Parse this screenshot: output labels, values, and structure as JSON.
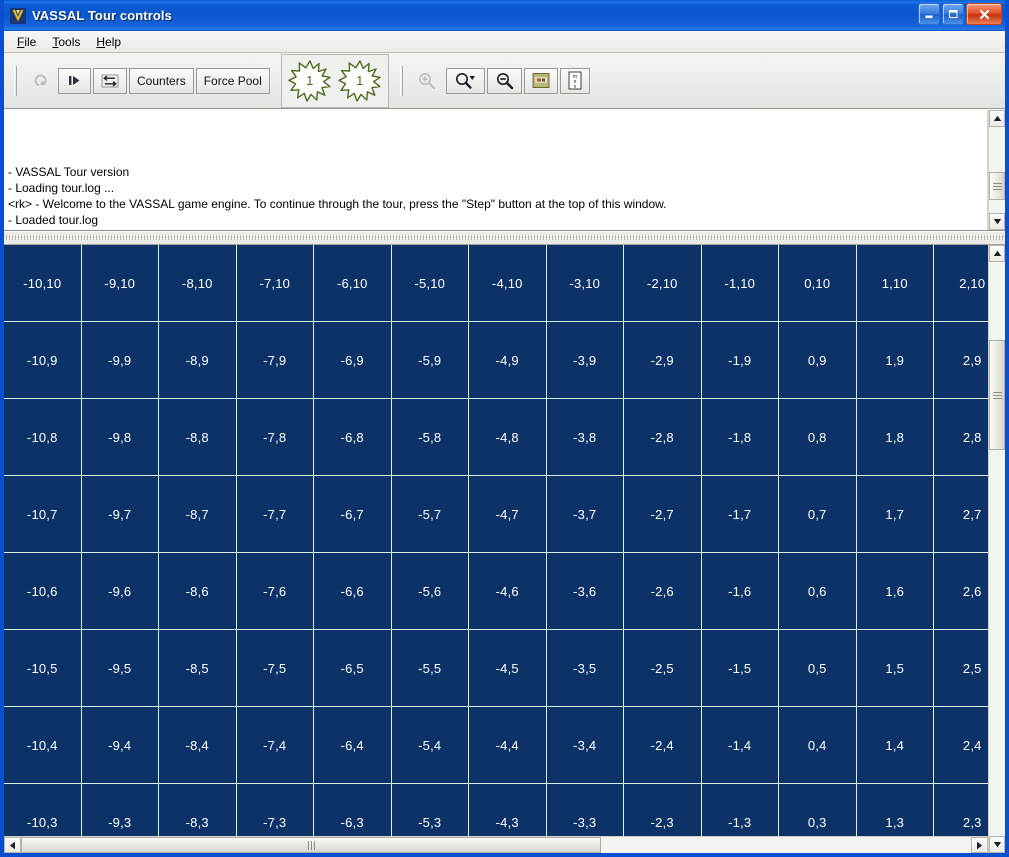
{
  "window": {
    "title": "VASSAL Tour controls",
    "icon": "vassal-logo-icon",
    "buttons": {
      "minimize": "minimize-icon",
      "maximize": "maximize-icon",
      "close": "close-icon"
    }
  },
  "menubar": {
    "items": [
      {
        "label": "File",
        "mnemonic": "F"
      },
      {
        "label": "Tools",
        "mnemonic": "T"
      },
      {
        "label": "Help",
        "mnemonic": "H"
      }
    ]
  },
  "toolbar": {
    "undo": {
      "name": "undo-button",
      "tooltip": "Undo",
      "enabled": false
    },
    "step": {
      "name": "step-button",
      "tooltip": "Step"
    },
    "swap": {
      "name": "swap-sides-button",
      "tooltip": "Swap sides"
    },
    "counters_label": "Counters",
    "force_pool_label": "Force Pool",
    "counter_badges": [
      {
        "label": "1",
        "color": "#4a6b1e"
      },
      {
        "label": "1",
        "color": "#4a6b1e"
      }
    ],
    "zoom_in": {
      "name": "zoom-in-button",
      "enabled": false
    },
    "zoom_select": {
      "name": "zoom-select-button",
      "enabled": true
    },
    "zoom_out": {
      "name": "zoom-out-button",
      "enabled": true
    },
    "overview": {
      "name": "overview-map-button",
      "enabled": true
    },
    "mov": {
      "name": "mov-marker-button",
      "label": "mov",
      "enabled": true
    }
  },
  "log": {
    "lines": [
      "- VASSAL Tour version",
      "- Loading tour.log ...",
      "<rk> - Welcome to the VASSAL game engine.  To continue through the tour, press the \"Step\" button at the top of this window.",
      "- Loaded tour.log"
    ]
  },
  "map": {
    "background_color": "#0d3268",
    "gridline_color": "#d9f0e4",
    "label_color": "#ffffff",
    "columns": [
      -10,
      -9,
      -8,
      -7,
      -6,
      -5,
      -4,
      -3,
      -2,
      -1,
      0,
      1,
      2
    ],
    "rows": [
      10,
      9,
      8,
      7,
      6,
      5,
      4,
      3
    ],
    "cells": [
      [
        "-10,10",
        "-9,10",
        "-8,10",
        "-7,10",
        "-6,10",
        "-5,10",
        "-4,10",
        "-3,10",
        "-2,10",
        "-1,10",
        "0,10",
        "1,10",
        "2,10"
      ],
      [
        "-10,9",
        "-9,9",
        "-8,9",
        "-7,9",
        "-6,9",
        "-5,9",
        "-4,9",
        "-3,9",
        "-2,9",
        "-1,9",
        "0,9",
        "1,9",
        "2,9"
      ],
      [
        "-10,8",
        "-9,8",
        "-8,8",
        "-7,8",
        "-6,8",
        "-5,8",
        "-4,8",
        "-3,8",
        "-2,8",
        "-1,8",
        "0,8",
        "1,8",
        "2,8"
      ],
      [
        "-10,7",
        "-9,7",
        "-8,7",
        "-7,7",
        "-6,7",
        "-5,7",
        "-4,7",
        "-3,7",
        "-2,7",
        "-1,7",
        "0,7",
        "1,7",
        "2,7"
      ],
      [
        "-10,6",
        "-9,6",
        "-8,6",
        "-7,6",
        "-6,6",
        "-5,6",
        "-4,6",
        "-3,6",
        "-2,6",
        "-1,6",
        "0,6",
        "1,6",
        "2,6"
      ],
      [
        "-10,5",
        "-9,5",
        "-8,5",
        "-7,5",
        "-6,5",
        "-5,5",
        "-4,5",
        "-3,5",
        "-2,5",
        "-1,5",
        "0,5",
        "1,5",
        "2,5"
      ],
      [
        "-10,4",
        "-9,4",
        "-8,4",
        "-7,4",
        "-6,4",
        "-5,4",
        "-4,4",
        "-3,4",
        "-2,4",
        "-1,4",
        "0,4",
        "1,4",
        "2,4"
      ],
      [
        "-10,3",
        "-9,3",
        "-8,3",
        "-7,3",
        "-6,3",
        "-5,3",
        "-4,3",
        "-3,3",
        "-2,3",
        "-1,3",
        "0,3",
        "1,3",
        "2,3"
      ]
    ]
  },
  "scrollbars": {
    "log_vertical": {
      "name": "log-vertical-scrollbar"
    },
    "map_vertical": {
      "name": "map-vertical-scrollbar"
    },
    "map_horizontal": {
      "name": "map-horizontal-scrollbar"
    }
  }
}
